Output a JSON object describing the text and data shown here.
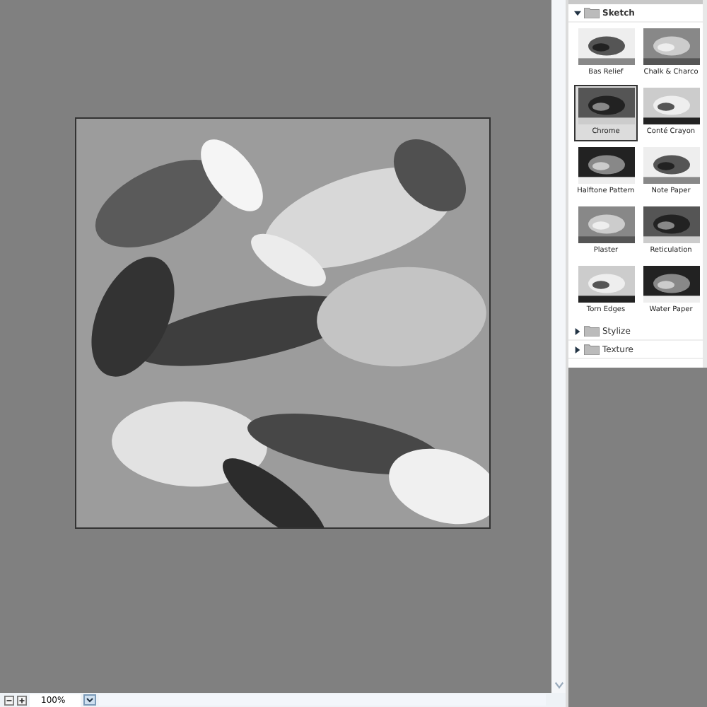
{
  "bottom_bar": {
    "zoom": {
      "value": "100%"
    }
  },
  "filter_panel": {
    "folders": [
      {
        "label": "Sketch",
        "expanded": true,
        "items": [
          {
            "label": "Bas Relief",
            "selected": false
          },
          {
            "label": "Chalk & Charco",
            "selected": false
          },
          {
            "label": "Chrome",
            "selected": true
          },
          {
            "label": "Conté Crayon",
            "selected": false
          },
          {
            "label": "Halftone Pattern",
            "selected": false
          },
          {
            "label": "Note Paper",
            "selected": false
          },
          {
            "label": "Plaster",
            "selected": false
          },
          {
            "label": "Reticulation",
            "selected": false
          },
          {
            "label": "Torn Edges",
            "selected": false
          },
          {
            "label": "Water Paper",
            "selected": false
          }
        ]
      },
      {
        "label": "Stylize",
        "expanded": false
      },
      {
        "label": "Texture",
        "expanded": false
      }
    ]
  }
}
